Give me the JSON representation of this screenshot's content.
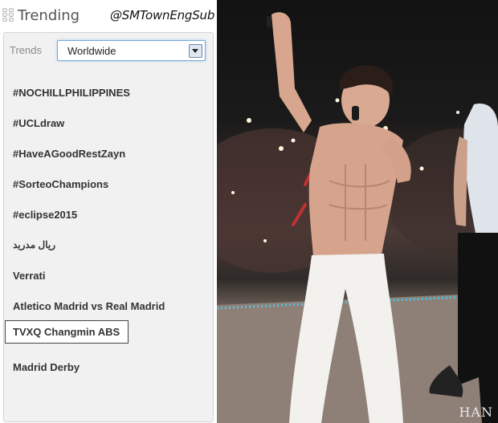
{
  "header": {
    "title": "Trending",
    "watermark": "@SMTownEngSub"
  },
  "trends": {
    "label": "Trends",
    "location": "Worldwide",
    "items": [
      "#NOCHILLPHILIPPINES",
      "#UCLdraw",
      "#HaveAGoodRestZayn",
      "#SorteoChampions",
      "#eclipse2015",
      "ريال مدريد",
      "Verrati",
      "Atletico Madrid vs Real Madrid",
      "TVXQ Changmin ABS",
      "Madrid Derby"
    ],
    "highlighted_index": 8
  },
  "photo": {
    "caption": "HAN",
    "icon": "concert-photo"
  }
}
